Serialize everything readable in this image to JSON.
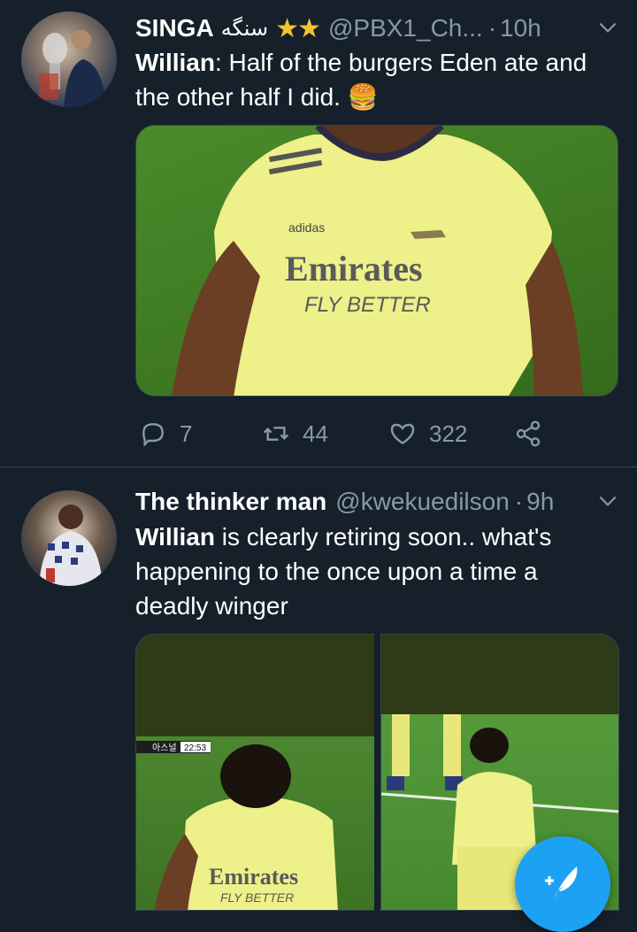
{
  "tweets": [
    {
      "display_name": "SINGA",
      "name_suffix": "سنگه",
      "stars": "★★",
      "handle": "@PBX1_Ch...",
      "separator": "·",
      "time": "10h",
      "text_bold": "Willian",
      "text": ": Half of the burgers Eden ate and the other half I did.",
      "emoji": "🍔",
      "media_text": {
        "sponsor_line1": "Emirates",
        "sponsor_line2": "FLY BETTER",
        "brand": "adidas"
      },
      "actions": {
        "replies": "7",
        "retweets": "44",
        "likes": "322"
      }
    },
    {
      "display_name": "The thinker man",
      "handle": "@kwekuedilson",
      "separator": "·",
      "time": "9h",
      "text_bold": "Willian",
      "text": " is clearly retiring soon.. what's happening to the once upon a time a deadly winger",
      "media_left_text": {
        "scoreboard_team": "아스널",
        "scoreboard_time": "22:53",
        "sponsor_line1": "Emirates",
        "sponsor_line2": "FLY BETTER"
      }
    }
  ],
  "colors": {
    "background": "#15202b",
    "accent": "#1da1f2",
    "secondary_text": "#8899a6",
    "divider": "#38444d"
  },
  "icons": [
    "chevron-down-icon",
    "reply-icon",
    "retweet-icon",
    "like-icon",
    "share-icon",
    "compose-icon"
  ]
}
